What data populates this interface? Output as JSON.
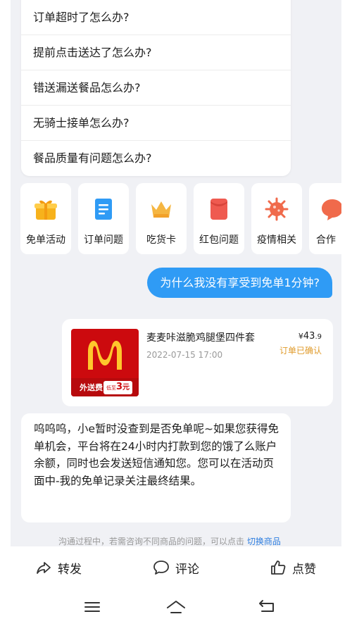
{
  "faq": {
    "items": [
      "订单超时了怎么办?",
      "提前点击送达了怎么办?",
      "错送漏送餐品怎么办?",
      "无骑士接单怎么办?",
      "餐品质量有问题怎么办?"
    ]
  },
  "quick_actions": [
    {
      "label": "免单活动",
      "icon": "gift-icon",
      "color": "#f7b21c"
    },
    {
      "label": "订单问题",
      "icon": "document-icon",
      "color": "#2f9bf5"
    },
    {
      "label": "吃货卡",
      "icon": "crown-icon",
      "color": "#f5b642"
    },
    {
      "label": "红包问题",
      "icon": "red-envelope-icon",
      "color": "#ef5a50"
    },
    {
      "label": "疫情相关",
      "icon": "virus-icon",
      "color": "#f06a4b"
    },
    {
      "label": "合作",
      "icon": "chat-heart-icon",
      "color": "#f06a4b"
    }
  ],
  "user_message": "为什么我没有享受到免单1分钟?",
  "order": {
    "title": "麦麦咔滋脆鸡腿堡四件套",
    "date": "2022-07-15 17:00",
    "price_symbol": "¥",
    "price_int": "43",
    "price_dec": ".9",
    "status": "订单已确认",
    "fee_label": "外送费",
    "fee_small": "低至",
    "fee_value": "3",
    "fee_unit": "元",
    "colors": {
      "brand_red": "#cc0a0e",
      "arches": "#ffc72c"
    }
  },
  "bot_message": "呜呜呜，小e暂时没查到是否免单呢~如果您获得免单机会，平台将在24小时内打款到您的饿了么账户余额，同时也会发送短信通知您。您可以在活动页面中-我的免单记录关注最终结果。",
  "hint": {
    "text": "沟通过程中，若需咨询不同商品的问题，可以点击",
    "link": "切换商品"
  },
  "actions": {
    "share": "转发",
    "comment": "评论",
    "like": "点赞"
  },
  "colors": {
    "accent": "#2f9bf5",
    "chat_bg": "#f0f1f5",
    "status_orange": "#e09b2b"
  }
}
